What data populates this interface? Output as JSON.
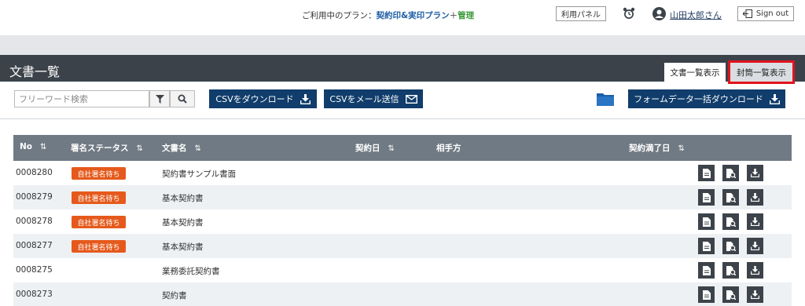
{
  "top": {
    "plan_prefix": "ご利用中のプラン：",
    "plan_name": "契約印&実印プラン",
    "plan_plus": "＋",
    "plan_extra": "管理",
    "panel_label": "利用パネル",
    "user_name": "山田太郎さん",
    "signout_label": "Sign out"
  },
  "header": {
    "title": "文書一覧",
    "tabs": [
      {
        "label": "文書一覧表示"
      },
      {
        "label": "封筒一覧表示"
      }
    ]
  },
  "toolbar": {
    "search_placeholder": "フリーワード検索",
    "csv_download": "CSVをダウンロード",
    "csv_mail": "CSVをメール送信",
    "form_download": "フォームデータ一括ダウンロード"
  },
  "table": {
    "columns": [
      "No",
      "署名ステータス",
      "文書名",
      "契約日",
      "相手方",
      "契約満了日"
    ],
    "sort_icon": "⇅",
    "rows": [
      {
        "no": "0008280",
        "status": "自社署名待ち",
        "name": "契約書サンプル書面"
      },
      {
        "no": "0008279",
        "status": "自社署名待ち",
        "name": "基本契約書"
      },
      {
        "no": "0008278",
        "status": "自社署名待ち",
        "name": "基本契約書"
      },
      {
        "no": "0008277",
        "status": "自社署名待ち",
        "name": "基本契約書"
      },
      {
        "no": "0008275",
        "status": "",
        "name": "業務委託契約書"
      },
      {
        "no": "0008273",
        "status": "",
        "name": "契約書"
      }
    ]
  },
  "colors": {
    "header_bg": "#3b424a",
    "navy_button": "#103d6b",
    "table_header": "#707a84",
    "badge": "#e55a1c",
    "highlight_border": "#e0141e"
  }
}
